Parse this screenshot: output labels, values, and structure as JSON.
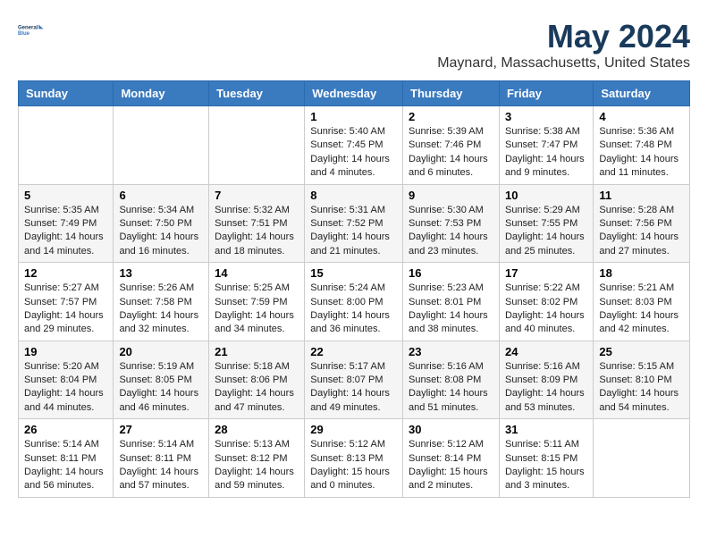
{
  "header": {
    "logo_line1": "General",
    "logo_line2": "Blue",
    "month_year": "May 2024",
    "location": "Maynard, Massachusetts, United States"
  },
  "days_of_week": [
    "Sunday",
    "Monday",
    "Tuesday",
    "Wednesday",
    "Thursday",
    "Friday",
    "Saturday"
  ],
  "weeks": [
    [
      {
        "day": "",
        "info": ""
      },
      {
        "day": "",
        "info": ""
      },
      {
        "day": "",
        "info": ""
      },
      {
        "day": "1",
        "info": "Sunrise: 5:40 AM\nSunset: 7:45 PM\nDaylight: 14 hours\nand 4 minutes."
      },
      {
        "day": "2",
        "info": "Sunrise: 5:39 AM\nSunset: 7:46 PM\nDaylight: 14 hours\nand 6 minutes."
      },
      {
        "day": "3",
        "info": "Sunrise: 5:38 AM\nSunset: 7:47 PM\nDaylight: 14 hours\nand 9 minutes."
      },
      {
        "day": "4",
        "info": "Sunrise: 5:36 AM\nSunset: 7:48 PM\nDaylight: 14 hours\nand 11 minutes."
      }
    ],
    [
      {
        "day": "5",
        "info": "Sunrise: 5:35 AM\nSunset: 7:49 PM\nDaylight: 14 hours\nand 14 minutes."
      },
      {
        "day": "6",
        "info": "Sunrise: 5:34 AM\nSunset: 7:50 PM\nDaylight: 14 hours\nand 16 minutes."
      },
      {
        "day": "7",
        "info": "Sunrise: 5:32 AM\nSunset: 7:51 PM\nDaylight: 14 hours\nand 18 minutes."
      },
      {
        "day": "8",
        "info": "Sunrise: 5:31 AM\nSunset: 7:52 PM\nDaylight: 14 hours\nand 21 minutes."
      },
      {
        "day": "9",
        "info": "Sunrise: 5:30 AM\nSunset: 7:53 PM\nDaylight: 14 hours\nand 23 minutes."
      },
      {
        "day": "10",
        "info": "Sunrise: 5:29 AM\nSunset: 7:55 PM\nDaylight: 14 hours\nand 25 minutes."
      },
      {
        "day": "11",
        "info": "Sunrise: 5:28 AM\nSunset: 7:56 PM\nDaylight: 14 hours\nand 27 minutes."
      }
    ],
    [
      {
        "day": "12",
        "info": "Sunrise: 5:27 AM\nSunset: 7:57 PM\nDaylight: 14 hours\nand 29 minutes."
      },
      {
        "day": "13",
        "info": "Sunrise: 5:26 AM\nSunset: 7:58 PM\nDaylight: 14 hours\nand 32 minutes."
      },
      {
        "day": "14",
        "info": "Sunrise: 5:25 AM\nSunset: 7:59 PM\nDaylight: 14 hours\nand 34 minutes."
      },
      {
        "day": "15",
        "info": "Sunrise: 5:24 AM\nSunset: 8:00 PM\nDaylight: 14 hours\nand 36 minutes."
      },
      {
        "day": "16",
        "info": "Sunrise: 5:23 AM\nSunset: 8:01 PM\nDaylight: 14 hours\nand 38 minutes."
      },
      {
        "day": "17",
        "info": "Sunrise: 5:22 AM\nSunset: 8:02 PM\nDaylight: 14 hours\nand 40 minutes."
      },
      {
        "day": "18",
        "info": "Sunrise: 5:21 AM\nSunset: 8:03 PM\nDaylight: 14 hours\nand 42 minutes."
      }
    ],
    [
      {
        "day": "19",
        "info": "Sunrise: 5:20 AM\nSunset: 8:04 PM\nDaylight: 14 hours\nand 44 minutes."
      },
      {
        "day": "20",
        "info": "Sunrise: 5:19 AM\nSunset: 8:05 PM\nDaylight: 14 hours\nand 46 minutes."
      },
      {
        "day": "21",
        "info": "Sunrise: 5:18 AM\nSunset: 8:06 PM\nDaylight: 14 hours\nand 47 minutes."
      },
      {
        "day": "22",
        "info": "Sunrise: 5:17 AM\nSunset: 8:07 PM\nDaylight: 14 hours\nand 49 minutes."
      },
      {
        "day": "23",
        "info": "Sunrise: 5:16 AM\nSunset: 8:08 PM\nDaylight: 14 hours\nand 51 minutes."
      },
      {
        "day": "24",
        "info": "Sunrise: 5:16 AM\nSunset: 8:09 PM\nDaylight: 14 hours\nand 53 minutes."
      },
      {
        "day": "25",
        "info": "Sunrise: 5:15 AM\nSunset: 8:10 PM\nDaylight: 14 hours\nand 54 minutes."
      }
    ],
    [
      {
        "day": "26",
        "info": "Sunrise: 5:14 AM\nSunset: 8:11 PM\nDaylight: 14 hours\nand 56 minutes."
      },
      {
        "day": "27",
        "info": "Sunrise: 5:14 AM\nSunset: 8:11 PM\nDaylight: 14 hours\nand 57 minutes."
      },
      {
        "day": "28",
        "info": "Sunrise: 5:13 AM\nSunset: 8:12 PM\nDaylight: 14 hours\nand 59 minutes."
      },
      {
        "day": "29",
        "info": "Sunrise: 5:12 AM\nSunset: 8:13 PM\nDaylight: 15 hours\nand 0 minutes."
      },
      {
        "day": "30",
        "info": "Sunrise: 5:12 AM\nSunset: 8:14 PM\nDaylight: 15 hours\nand 2 minutes."
      },
      {
        "day": "31",
        "info": "Sunrise: 5:11 AM\nSunset: 8:15 PM\nDaylight: 15 hours\nand 3 minutes."
      },
      {
        "day": "",
        "info": ""
      }
    ]
  ]
}
